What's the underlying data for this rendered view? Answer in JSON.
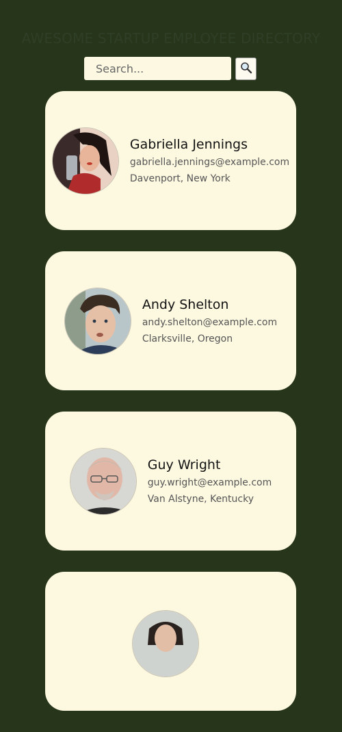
{
  "header": {
    "title": "AWESOME STARTUP EMPLOYEE DIRECTORY"
  },
  "search": {
    "placeholder": "Search...",
    "value": "",
    "button_icon": "magnifier-icon"
  },
  "employees": [
    {
      "name": "Gabriella Jennings",
      "email": "gabriella.jennings@example.com",
      "location": "Davenport, New York"
    },
    {
      "name": "Andy Shelton",
      "email": "andy.shelton@example.com",
      "location": "Clarksville, Oregon"
    },
    {
      "name": "Guy Wright",
      "email": "guy.wright@example.com",
      "location": "Van Alstyne, Kentucky"
    },
    {
      "name": "",
      "email": "",
      "location": ""
    }
  ],
  "colors": {
    "background": "#27361a",
    "card": "#fdf9e1",
    "title_text": "#2f3e27"
  }
}
